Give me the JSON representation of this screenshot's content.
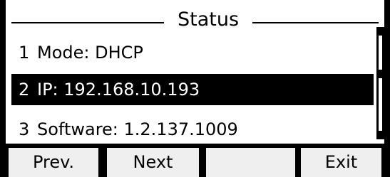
{
  "header": {
    "title": "Status"
  },
  "status_items": [
    {
      "index": "1",
      "text": "Mode: DHCP"
    },
    {
      "index": "2",
      "text": "IP: 192.168.10.193"
    },
    {
      "index": "3",
      "text": "Software: 1.2.137.1009"
    }
  ],
  "selected_index": 2,
  "softkeys": {
    "prev": "Prev.",
    "next": "Next",
    "blank": "",
    "exit": "Exit"
  },
  "colors": {
    "foreground": "#000000",
    "background": "#ffffff",
    "highlight": "#000000",
    "softkey_bg": "#efefef"
  }
}
